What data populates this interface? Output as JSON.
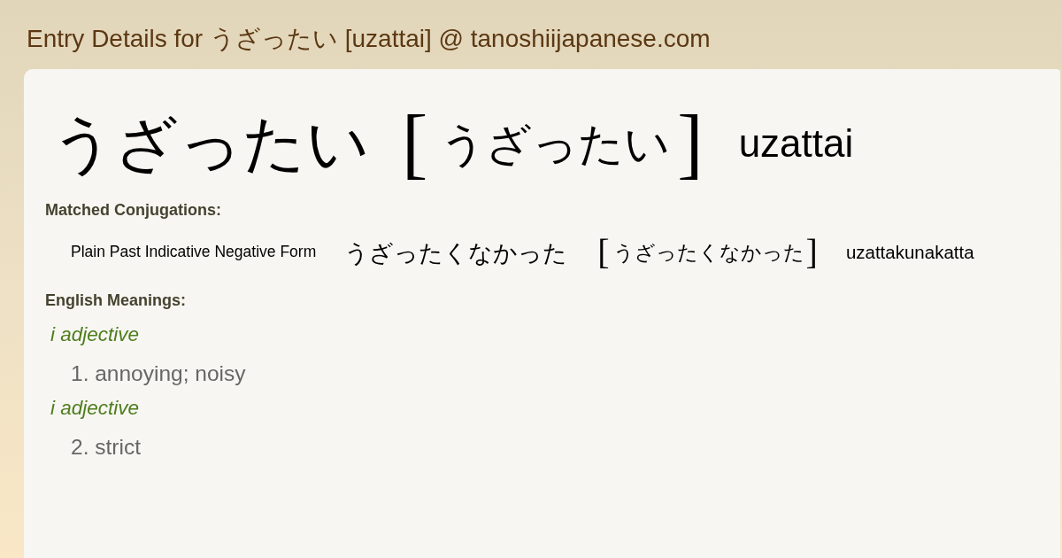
{
  "page_title": "Entry Details for うざったい [uzattai] @ tanoshiijapanese.com",
  "entry": {
    "headword": "うざったい",
    "bracket_open": "[",
    "reading": "うざったい",
    "bracket_close": "]",
    "romaji": "uzattai"
  },
  "conjugations": {
    "heading": "Matched Conjugations:",
    "items": [
      {
        "form": "Plain Past Indicative Negative Form",
        "japanese": "うざったくなかった",
        "bracket_open": "[",
        "reading": "うざったくなかった",
        "bracket_close": "]",
        "romaji": "uzattakunakatta"
      }
    ]
  },
  "meanings": {
    "heading": "English Meanings:",
    "senses": [
      {
        "part_of_speech": "i adjective",
        "gloss": "1. annoying; noisy"
      },
      {
        "part_of_speech": "i adjective",
        "gloss": "2. strict"
      }
    ]
  }
}
